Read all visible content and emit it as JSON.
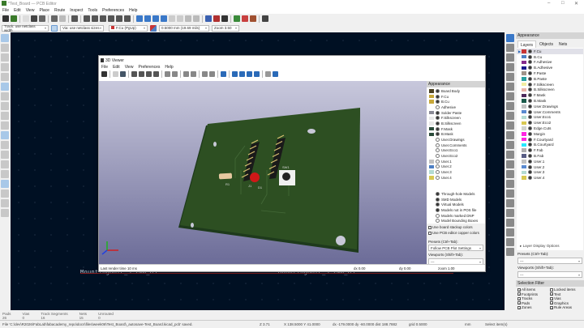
{
  "window": {
    "title": "*Test_Board — PCB Editor"
  },
  "menu": [
    "File",
    "Edit",
    "View",
    "Place",
    "Route",
    "Inspect",
    "Tools",
    "Preferences",
    "Help"
  ],
  "options": {
    "track": "Track: use netclass width",
    "via": "Via: use netclass sizes",
    "layer": "F.Cu (PgUp)",
    "grid": "0.5000 mm (19.69 mils)",
    "zoom": "Zoom 3.50"
  },
  "canvas": {
    "labels": [
      "MountingHole_3.2mm_M3",
      "MountingHole_3.2mm_M3"
    ]
  },
  "viewer3d": {
    "title": "3D Viewer",
    "menu": [
      "File",
      "Edit",
      "View",
      "Preferences",
      "Help"
    ],
    "appearance_title": "Appearance",
    "items": [
      {
        "label": "Board Body",
        "color": "#4a4020"
      },
      {
        "label": "F.Cu",
        "color": "#c8a83a"
      },
      {
        "label": "B.Cu",
        "color": "#c8a83a"
      },
      {
        "label": "Adhesive",
        "color": ""
      },
      {
        "label": "Solder Paste",
        "color": "#8a8a96"
      },
      {
        "label": "F.Silkscreen",
        "color": "#e8e8e8"
      },
      {
        "label": "B.Silkscreen",
        "color": "#e8e8e8"
      },
      {
        "label": "F.Mask",
        "color": "#2a4a3a"
      },
      {
        "label": "B.Mask",
        "color": "#2a4a3a"
      },
      {
        "label": "User.Drawings",
        "color": ""
      },
      {
        "label": "User.Comments",
        "color": ""
      },
      {
        "label": "User.Eco1",
        "color": ""
      },
      {
        "label": "User.Eco2",
        "color": ""
      },
      {
        "label": "User.1",
        "color": "#c2c2c2"
      },
      {
        "label": "User.2",
        "color": "#4d7fc4"
      },
      {
        "label": "User.3",
        "color": "#b4dbd2"
      },
      {
        "label": "User.4",
        "color": "#d8c852"
      }
    ],
    "models": [
      "Through-hole Models",
      "SMD Models",
      "Virtual Models",
      "Models not in POS file",
      "Models marked DNP",
      "Model Bounding Boxes"
    ],
    "checks": [
      "Use board stackup colors",
      "Use PCB editor copper colors"
    ],
    "presets_label": "Presets (Ctrl+Tab):",
    "presets_value": "Follow PCB Plot Settings",
    "viewports_label": "Viewports (Shift+Tab):",
    "viewports_value": "---",
    "status": {
      "render": "Last render time 10 ms",
      "dx": "dx 0.00",
      "dy": "dy 0.00",
      "zoom": "zoom 1.00"
    },
    "board_labels": {
      "j1": "J1",
      "r1": "R1",
      "d1": "D1",
      "sw1": "SW1"
    }
  },
  "right_panel": {
    "title": "Appearance",
    "tabs": [
      "Layers",
      "Objects",
      "Nets"
    ],
    "layers": [
      {
        "label": "F.Cu",
        "color": "#c83434"
      },
      {
        "label": "B.Cu",
        "color": "#4d7fc4"
      },
      {
        "label": "F.Adhesive",
        "color": "#842a8c"
      },
      {
        "label": "B.Adhesive",
        "color": "#1a1a8c"
      },
      {
        "label": "F.Paste",
        "color": "#a0948a"
      },
      {
        "label": "B.Paste",
        "color": "#2aa0a0"
      },
      {
        "label": "F.Silkscreen",
        "color": "#f2eda1"
      },
      {
        "label": "B.Silkscreen",
        "color": "#e8b2a7"
      },
      {
        "label": "F.Mask",
        "color": "#4d2a5c"
      },
      {
        "label": "B.Mask",
        "color": "#1a5a4a"
      },
      {
        "label": "User.Drawings",
        "color": "#c2c2c2"
      },
      {
        "label": "User.Comments",
        "color": "#5a8ad0"
      },
      {
        "label": "User.Eco1",
        "color": "#b4dbd2"
      },
      {
        "label": "User.Eco2",
        "color": "#d8c852"
      },
      {
        "label": "Edge.Cuts",
        "color": "#d0d2cd"
      },
      {
        "label": "Margin",
        "color": "#ff26e2"
      },
      {
        "label": "F.Courtyard",
        "color": "#ff26e2"
      },
      {
        "label": "B.Courtyard",
        "color": "#26e9ff"
      },
      {
        "label": "F.Fab",
        "color": "#afafaf"
      },
      {
        "label": "B.Fab",
        "color": "#585d84"
      },
      {
        "label": "User.1",
        "color": "#c2c2c2"
      },
      {
        "label": "User.2",
        "color": "#5a8ad0"
      },
      {
        "label": "User.3",
        "color": "#b4dbd2"
      },
      {
        "label": "User.4",
        "color": "#d8c852"
      }
    ],
    "layer_display": "▸ Layer Display Options",
    "presets_label": "Presets (Ctrl+Tab):",
    "presets_value": "---",
    "viewports_label": "Viewports (Shift+Tab):",
    "viewports_value": "---",
    "selection_title": "Selection Filter",
    "filters": [
      "All items",
      "Locked items",
      "Footprints",
      "Text",
      "Tracks",
      "Vias",
      "Pads",
      "Graphics",
      "Zones",
      "Rule Areas",
      "Dimensions",
      "Other items"
    ]
  },
  "status": {
    "counts": [
      {
        "label": "Pads",
        "value": "26"
      },
      {
        "label": "Vias",
        "value": "0"
      },
      {
        "label": "Track Segments",
        "value": "16"
      },
      {
        "label": "Nets",
        "value": "15"
      },
      {
        "label": "Unrouted",
        "value": "0"
      }
    ],
    "message": "File 'C:\\dev\\R2026\\FabLab\\fabacademy_repo\\docs\\files\\week06\\Test_Board\\_autosave-Test_Board.kicad_pcb' saved.",
    "z": "Z 3.71",
    "xy": "X 138.5000  Y 41.0000",
    "delta": "dx -179.0000  dy -60.0000  dist 188.7882",
    "grid": "grid 0.5000",
    "units": "mm",
    "mode": "Select item(s)"
  }
}
